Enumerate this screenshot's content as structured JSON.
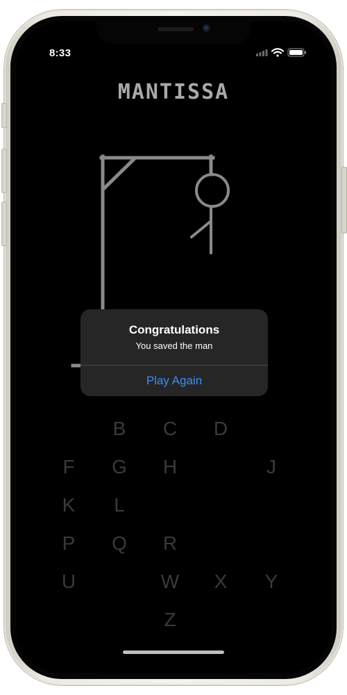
{
  "status_bar": {
    "time": "8:33",
    "icons": [
      "cellular-signal-icon",
      "wifi-icon",
      "battery-icon"
    ]
  },
  "app": {
    "title": "MANTISSA"
  },
  "keyboard": {
    "visible_letters": [
      "B",
      "C",
      "D",
      "F",
      "G",
      "H",
      "J",
      "K",
      "L",
      "P",
      "Q",
      "R",
      "U",
      "W",
      "X",
      "Y",
      "Z"
    ]
  },
  "alert": {
    "title": "Congratulations",
    "message": "You saved the man",
    "action_label": "Play Again",
    "action_color": "#3f8cf5"
  },
  "colors": {
    "background": "#000000",
    "drawing": "#8a8a8a",
    "letter_dim": "#3a3a3a",
    "alert_background": "#262626"
  }
}
